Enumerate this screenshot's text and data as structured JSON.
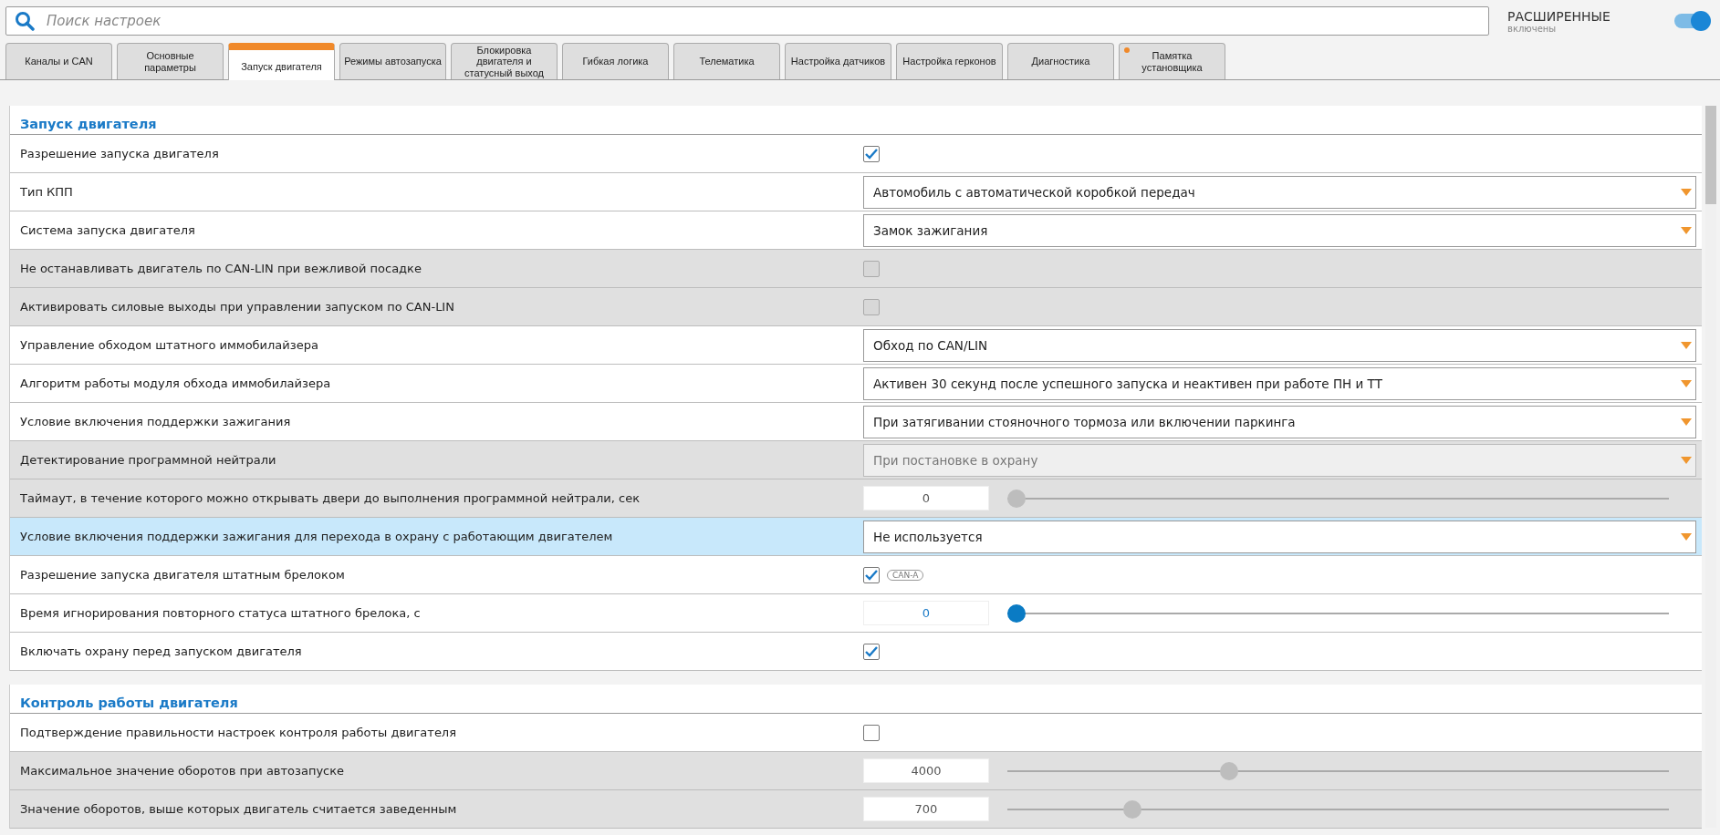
{
  "search": {
    "placeholder": "Поиск настроек"
  },
  "advanced": {
    "label": "РАСШИРЕННЫЕ",
    "status": "включены",
    "on": true
  },
  "tabs": [
    {
      "label": "Каналы и CAN",
      "selected": false,
      "marked": false
    },
    {
      "label": "Основные параметры",
      "selected": false,
      "marked": false
    },
    {
      "label": "Запуск двигателя",
      "selected": true,
      "marked": false
    },
    {
      "label": "Режимы автозапуска",
      "selected": false,
      "marked": false
    },
    {
      "label": "Блокировка двигателя и статусный выход",
      "selected": false,
      "marked": false
    },
    {
      "label": "Гибкая логика",
      "selected": false,
      "marked": false
    },
    {
      "label": "Телематика",
      "selected": false,
      "marked": false
    },
    {
      "label": "Настройка датчиков",
      "selected": false,
      "marked": false
    },
    {
      "label": "Настройка герконов",
      "selected": false,
      "marked": false
    },
    {
      "label": "Диагностика",
      "selected": false,
      "marked": false
    },
    {
      "label": "Памятка установщика",
      "selected": false,
      "marked": true
    }
  ],
  "sections": [
    {
      "title": "Запуск двигателя",
      "rows": [
        {
          "kind": "checkbox",
          "label": "Разрешение запуска двигателя",
          "disabled": false,
          "selected": false,
          "checked": true
        },
        {
          "kind": "select",
          "label": "Тип КПП",
          "disabled": false,
          "selected": false,
          "value": "Автомобиль с автоматической коробкой передач"
        },
        {
          "kind": "select",
          "label": "Система запуска двигателя",
          "disabled": false,
          "selected": false,
          "value": "Замок зажигания"
        },
        {
          "kind": "checkbox",
          "label": "Не останавливать двигатель по CAN-LIN при вежливой посадке",
          "disabled": true,
          "selected": false,
          "checked": false
        },
        {
          "kind": "checkbox",
          "label": "Активировать силовые выходы при управлении запуском по CAN-LIN",
          "disabled": true,
          "selected": false,
          "checked": false
        },
        {
          "kind": "select",
          "label": "Управление обходом штатного иммобилайзера",
          "disabled": false,
          "selected": false,
          "value": "Обход по CAN/LIN"
        },
        {
          "kind": "select",
          "label": "Алгоритм работы модуля обхода иммобилайзера",
          "disabled": false,
          "selected": false,
          "value": "Активен 30 секунд после успешного запуска и неактивен при работе ПН и ТТ"
        },
        {
          "kind": "select",
          "label": "Условие включения поддержки зажигания",
          "disabled": false,
          "selected": false,
          "value": "При затягивании стояночного тормоза или включении паркинга"
        },
        {
          "kind": "select",
          "label": "Детектирование программной нейтрали",
          "disabled": true,
          "selected": false,
          "value": "При постановке в охрану"
        },
        {
          "kind": "slider",
          "label": "Таймаут, в течение которого можно открывать двери до выполнения программной нейтрали, сек",
          "disabled": true,
          "selected": false,
          "value": "0",
          "level": 0
        },
        {
          "kind": "select",
          "label": "Условие включения поддержки зажигания для перехода в охрану с работающим двигателем",
          "disabled": false,
          "selected": true,
          "value": "Не используется"
        },
        {
          "kind": "checkbox",
          "label": "Разрешение запуска двигателя штатным брелоком",
          "disabled": false,
          "selected": false,
          "checked": true,
          "badge": "CAN-A"
        },
        {
          "kind": "slider",
          "label": "Время игнорирования повторного статуса штатного брелока, с",
          "disabled": false,
          "selected": false,
          "value": "0",
          "level": 0
        },
        {
          "kind": "checkbox",
          "label": "Включать охрану перед запуском двигателя",
          "disabled": false,
          "selected": false,
          "checked": true
        }
      ]
    },
    {
      "title": "Контроль работы двигателя",
      "rows": [
        {
          "kind": "checkbox",
          "label": "Подтверждение правильности настроек контроля работы двигателя",
          "disabled": false,
          "selected": false,
          "checked": false
        },
        {
          "kind": "slider",
          "label": "Максимальное значение оборотов при автозапуске",
          "disabled": true,
          "selected": false,
          "value": "4000",
          "level": 0.33
        },
        {
          "kind": "slider",
          "label": "Значение оборотов, выше которых двигатель считается заведенным",
          "disabled": true,
          "selected": false,
          "value": "700",
          "level": 0.18
        }
      ]
    }
  ]
}
